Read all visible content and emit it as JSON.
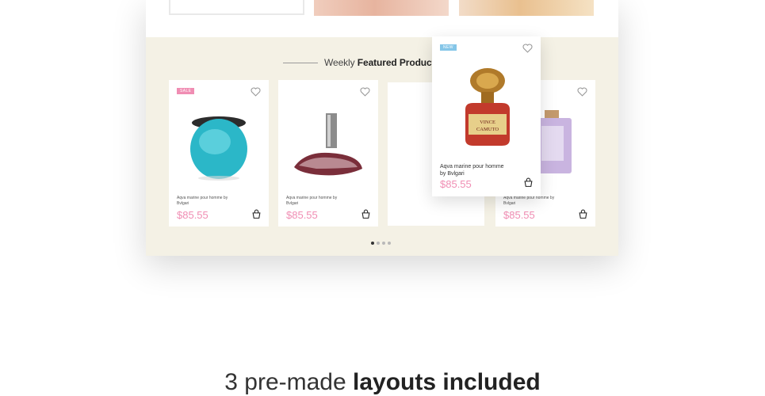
{
  "section": {
    "heading_light": "Weekly",
    "heading_bold": "Featured Product"
  },
  "products": [
    {
      "tag": "SALE",
      "name": "Aqva marine pour homme by Bvlgari",
      "price": "$85.55",
      "icon": "blue-perfume-bottle"
    },
    {
      "tag": "",
      "name": "Aqva marine pour homme by Bvlgari",
      "price": "$85.55",
      "icon": "euphoria-perfume-bottle"
    },
    {
      "tag": "",
      "name": "",
      "price": "",
      "icon": ""
    },
    {
      "tag": "",
      "name": "Aqva marine pour homme by Bvlgari",
      "price": "$85.55",
      "icon": "purple-perfume-bottle"
    }
  ],
  "popup": {
    "tag": "NEW",
    "name_line1": "Aqva marine pour homme",
    "name_line2": "by Bvlgari",
    "price": "$85.55",
    "bottle_label": "VINCE CAMUTO"
  },
  "carousel": {
    "pages": 4,
    "active": 1
  },
  "tagline": {
    "light": "3 pre-made",
    "bold": "layouts included"
  },
  "colors": {
    "accent": "#f08db3",
    "new_badge": "#85c6e8",
    "section_bg": "#f4f1e5"
  }
}
